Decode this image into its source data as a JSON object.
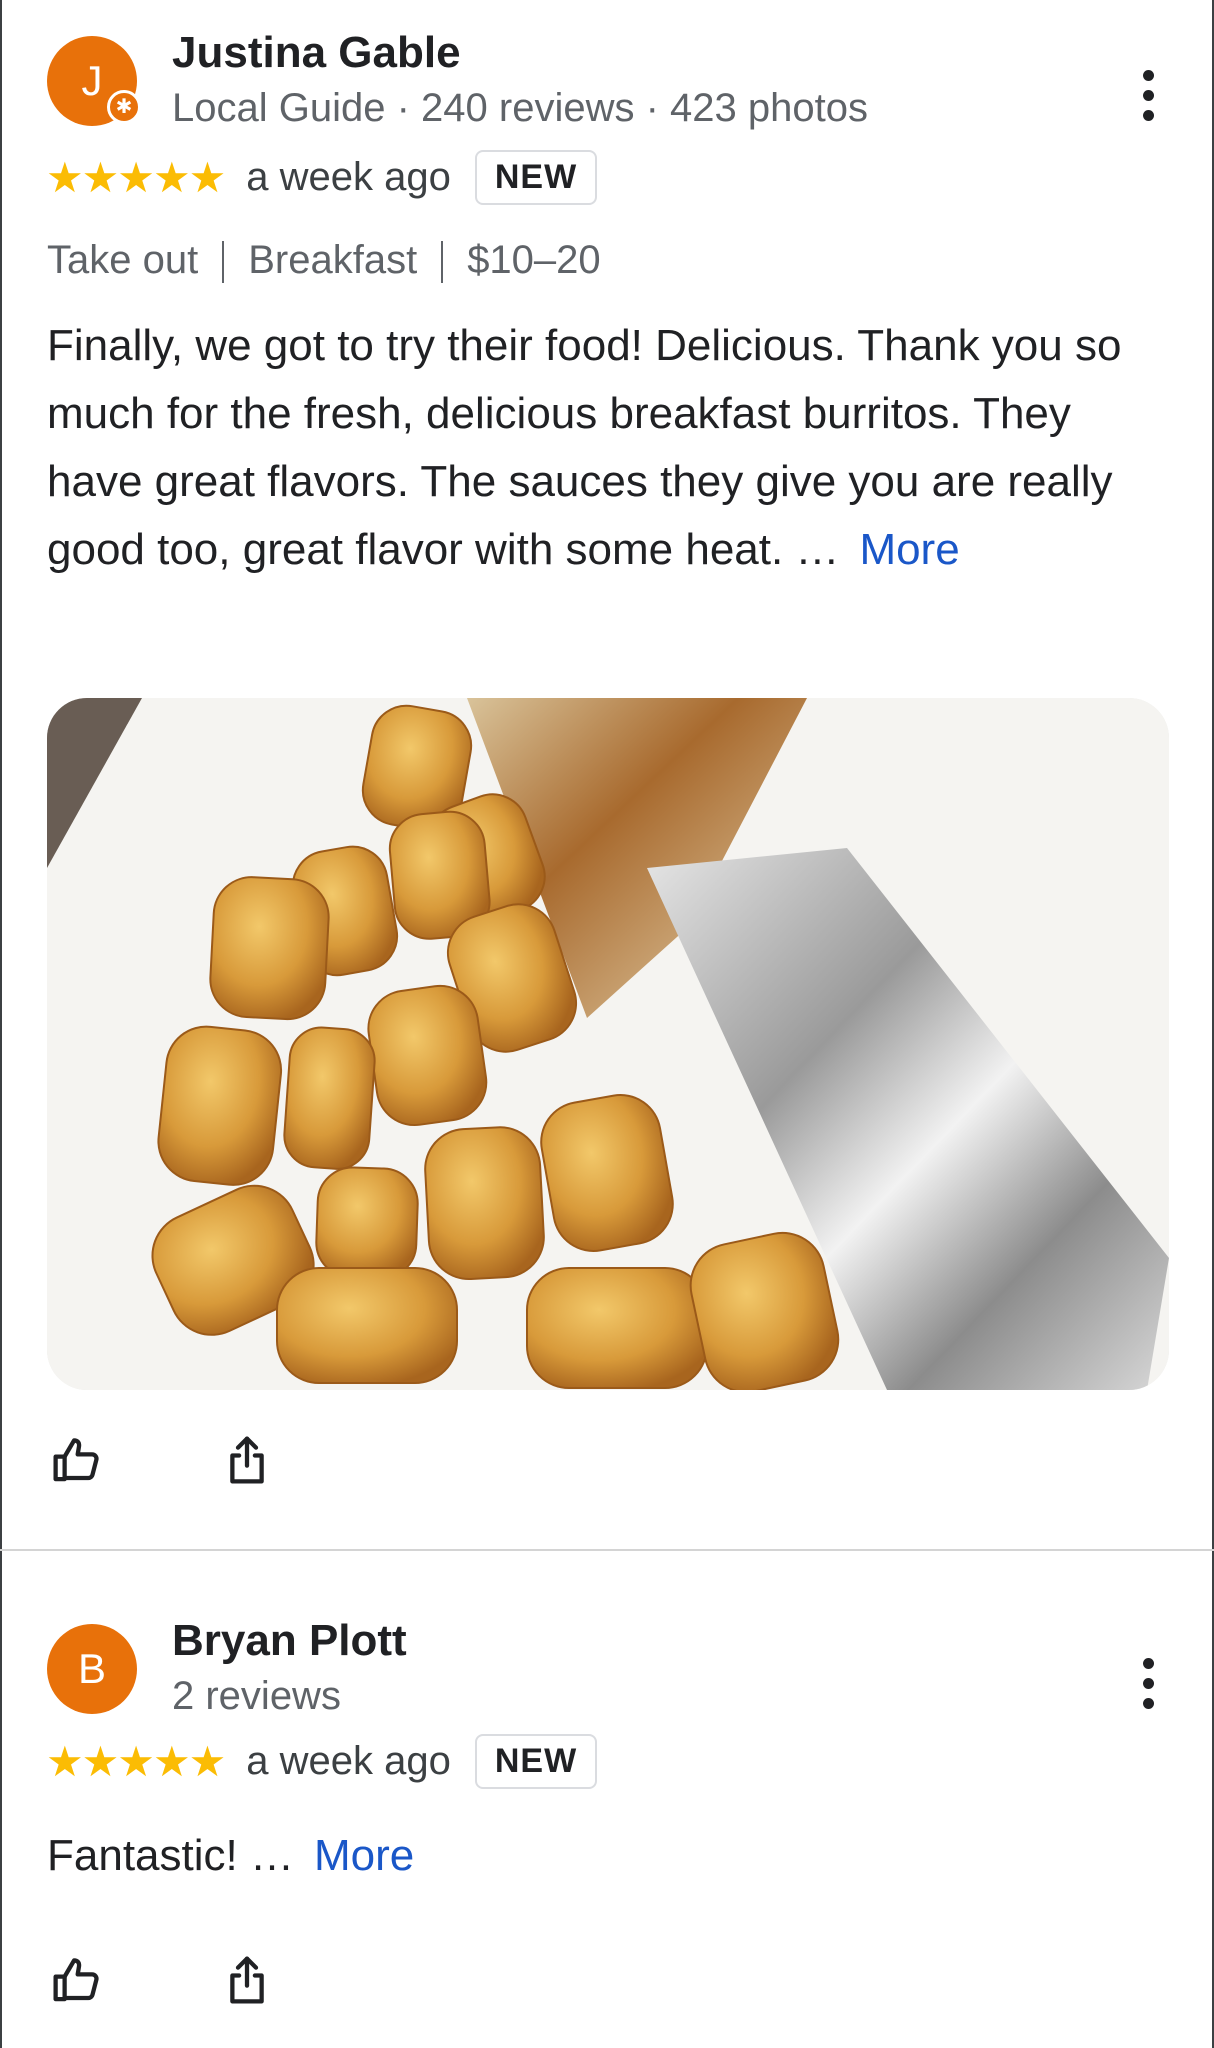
{
  "reviews": [
    {
      "avatar_letter": "J",
      "avatar_color": "#e8710a",
      "name": "Justina Gable",
      "meta": "Local Guide · 240 reviews · 423 photos",
      "stars": "★★★★★",
      "time": "a week ago",
      "badge": "NEW",
      "tags": [
        "Take out",
        "Breakfast",
        "$10–20"
      ],
      "text": "Finally, we got to try their food! Delicious. Thank you so much for the fresh, delicious breakfast burritos. They have great flavors. The sauces they give you are really good too, great flavor with some heat. …",
      "more": "More"
    },
    {
      "avatar_letter": "B",
      "avatar_color": "#e8710a",
      "name": "Bryan Plott",
      "meta": "2 reviews",
      "stars": "★★★★★",
      "time": "a week ago",
      "badge": "NEW",
      "text": "Fantastic! …",
      "more": "More"
    }
  ],
  "icons": {
    "more_options": "more-vert-icon",
    "like": "thumb-up-icon",
    "share": "share-icon",
    "local_guide": "local-guide-badge-icon"
  },
  "colors": {
    "star": "#fbbc04",
    "link": "#1a57c8",
    "avatar": "#e8710a"
  }
}
